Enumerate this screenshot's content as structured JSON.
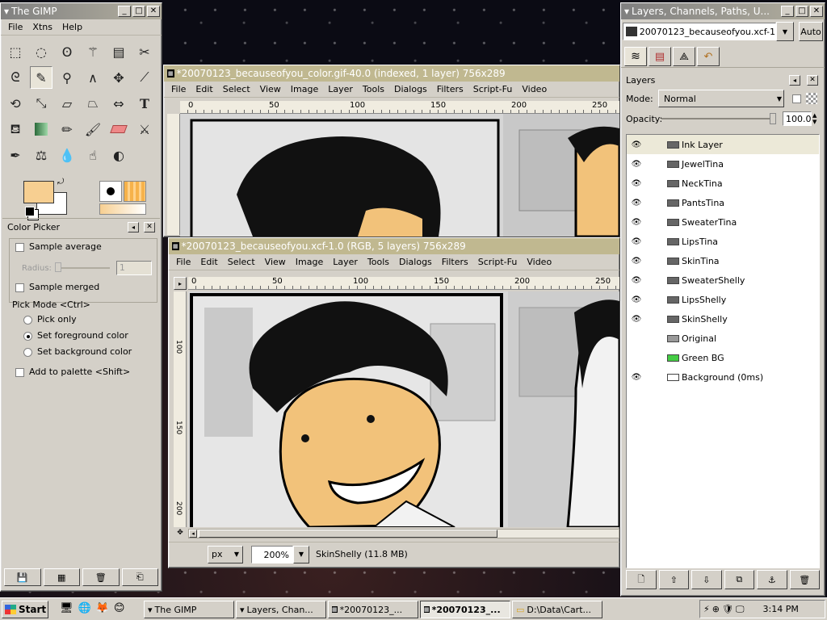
{
  "gimp_toolbox": {
    "title": "The GIMP",
    "menu": [
      "File",
      "Xtns",
      "Help"
    ]
  },
  "color_picker": {
    "title": "Color Picker",
    "sample_average": "Sample average",
    "radius_label": "Radius:",
    "radius_value": "1",
    "sample_merged": "Sample merged",
    "pick_mode": "Pick Mode  <Ctrl>",
    "pick_only": "Pick only",
    "set_fg": "Set foreground color",
    "set_bg": "Set background color",
    "add_palette": "Add to palette  <Shift>"
  },
  "img1": {
    "title": "*20070123_becauseofyou_color.gif-40.0 (indexed, 1 layer) 756x289",
    "menu": [
      "File",
      "Edit",
      "Select",
      "View",
      "Image",
      "Layer",
      "Tools",
      "Dialogs",
      "Filters",
      "Script-Fu",
      "Video"
    ],
    "ruler": [
      "0",
      "50",
      "100",
      "150",
      "200",
      "250"
    ]
  },
  "img2": {
    "title": "*20070123_becauseofyou.xcf-1.0 (RGB, 5 layers) 756x289",
    "menu": [
      "File",
      "Edit",
      "Select",
      "View",
      "Image",
      "Layer",
      "Tools",
      "Dialogs",
      "Filters",
      "Script-Fu",
      "Video"
    ],
    "ruler": [
      "0",
      "50",
      "100",
      "150",
      "200",
      "250"
    ],
    "vruler": [
      "100",
      "150",
      "200"
    ],
    "unit": "px",
    "zoom": "200%",
    "status": "SkinShelly (11.8 MB)"
  },
  "layers_dock": {
    "title": "Layers, Channels, Paths, U...",
    "image": "20070123_becauseofyou.xcf-1",
    "auto": "Auto",
    "tab_title": "Layers",
    "mode_label": "Mode:",
    "mode": "Normal",
    "opacity_label": "Opacity:",
    "opacity": "100.0",
    "layers": [
      {
        "name": "Ink Layer",
        "visible": true
      },
      {
        "name": "JewelTina",
        "visible": true
      },
      {
        "name": "NeckTina",
        "visible": true
      },
      {
        "name": "PantsTina",
        "visible": true
      },
      {
        "name": "SweaterTina",
        "visible": true
      },
      {
        "name": "LipsTina",
        "visible": true
      },
      {
        "name": "SkinTina",
        "visible": true
      },
      {
        "name": "SweaterShelly",
        "visible": true
      },
      {
        "name": "LipsShelly",
        "visible": true
      },
      {
        "name": "SkinShelly",
        "visible": true
      },
      {
        "name": "Original",
        "visible": false
      },
      {
        "name": "Green BG",
        "visible": false
      },
      {
        "name": "Background (0ms)",
        "visible": true
      }
    ]
  },
  "taskbar": {
    "start": "Start",
    "tasks": [
      "The GIMP",
      "Layers, Chan...",
      "*20070123_...",
      "*20070123_...",
      "D:\\Data\\Cart..."
    ],
    "clock": "3:14 PM"
  },
  "colors": {
    "fg": "#f7cf91",
    "bg": "#ffffff",
    "skin": "#f2c27a",
    "active_title": "#0a246a"
  }
}
